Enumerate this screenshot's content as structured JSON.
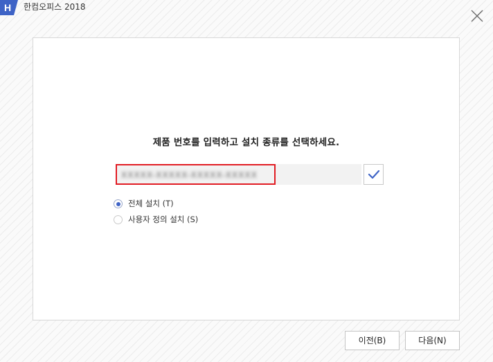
{
  "window": {
    "title": "한컴오피스 2018",
    "logo_letter": "H",
    "logo_color": "#3e63c6"
  },
  "main": {
    "heading": "제품 번호를 입력하고 설치 종류를 선택하세요.",
    "product_key": {
      "value": "XXXXX-XXXXX-XXXXX-XXXXX",
      "highlight_color": "#e11b22"
    },
    "verify_icon": "checkmark-icon",
    "install_types": [
      {
        "label": "전체 설치 (T)",
        "selected": true
      },
      {
        "label": "사용자 정의 설치 (S)",
        "selected": false
      }
    ]
  },
  "footer": {
    "prev_label": "이전(B)",
    "next_label": "다음(N)"
  },
  "colors": {
    "accent": "#3e63c6",
    "highlight": "#e11b22"
  }
}
